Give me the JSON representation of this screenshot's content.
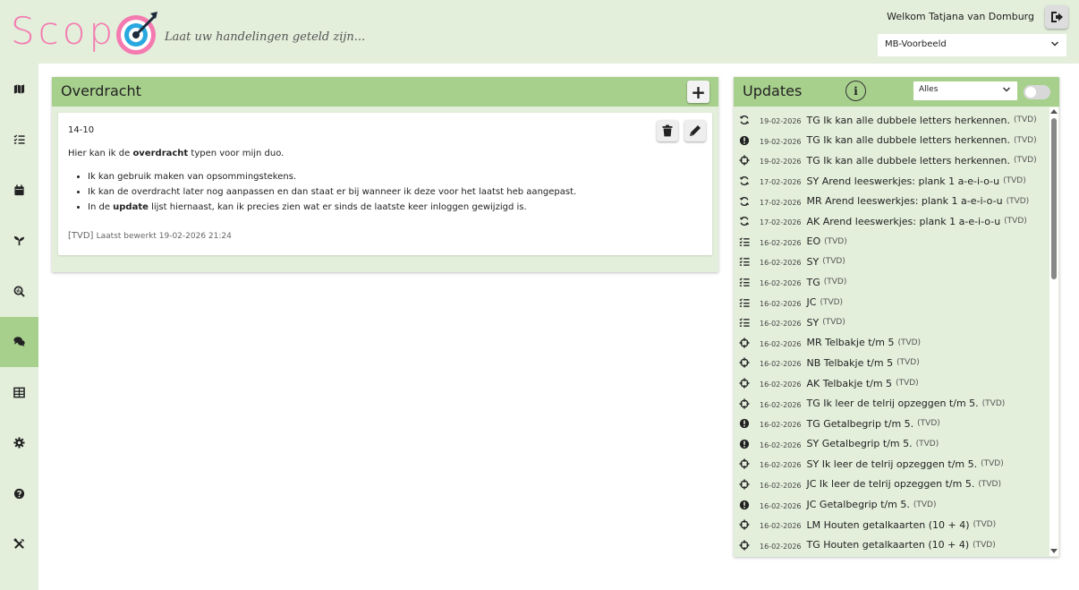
{
  "header": {
    "logo_text": "Scop",
    "tagline": "Laat uw handelingen geteld zijn...",
    "welcome": "Welkom Tatjana van Domburg",
    "school_select": "MB-Voorbeeld"
  },
  "colors": {
    "header_bg": "#e3eedb",
    "panel_head": "#a8d08d",
    "logo_pink": "#f47ab0",
    "logo_blue": "#2aa8e0"
  },
  "sidebar": {
    "items": [
      {
        "icon": "map-icon"
      },
      {
        "icon": "checklist-icon"
      },
      {
        "icon": "calendar-icon"
      },
      {
        "icon": "seedling-icon"
      },
      {
        "icon": "search-chart-icon"
      },
      {
        "icon": "chat-icon",
        "active": true
      },
      {
        "icon": "table-icon"
      },
      {
        "icon": "gear-icon"
      },
      {
        "icon": "help-icon"
      },
      {
        "icon": "tools-icon"
      }
    ]
  },
  "overdracht": {
    "title": "Overdracht",
    "add_label": "+",
    "note": {
      "date": "14-10",
      "intro_pre": "Hier kan ik de",
      "intro_bold": "overdracht",
      "intro_post": "typen voor mijn duo.",
      "bullets": [
        {
          "pre": "Ik kan gebruik maken van opsommingstekens.",
          "bold": "",
          "post": ""
        },
        {
          "pre": "Ik kan de overdracht later nog aanpassen en dan staat er bij wanneer ik deze voor het laatst heb aangepast.",
          "bold": "",
          "post": ""
        },
        {
          "pre": "In de",
          "bold": "update",
          "post": "lijst hiernaast, kan ik precies zien wat er sinds de laatste keer inloggen gewijzigd is."
        }
      ],
      "author": "[TVD]",
      "edited": "Laatst bewerkt 19-02-2026 21:24"
    }
  },
  "updates": {
    "title": "Updates",
    "info_label": "i",
    "filter": "Alles",
    "rows": [
      {
        "icon": "sync-icon",
        "date": "19-02-2026",
        "text": "TG Ik kan alle dubbele letters herkennen.",
        "by": "(TVD)"
      },
      {
        "icon": "alert-icon",
        "date": "19-02-2026",
        "text": "TG Ik kan alle dubbele letters herkennen.",
        "by": "(TVD)"
      },
      {
        "icon": "crosshair-icon",
        "date": "19-02-2026",
        "text": "TG Ik kan alle dubbele letters herkennen.",
        "by": "(TVD)"
      },
      {
        "icon": "sync-icon",
        "date": "17-02-2026",
        "text": "SY Arend leeswerkjes: plank 1 a-e-i-o-u",
        "by": "(TVD)"
      },
      {
        "icon": "sync-icon",
        "date": "17-02-2026",
        "text": "MR Arend leeswerkjes: plank 1 a-e-i-o-u",
        "by": "(TVD)"
      },
      {
        "icon": "sync-icon",
        "date": "17-02-2026",
        "text": "AK Arend leeswerkjes: plank 1 a-e-i-o-u",
        "by": "(TVD)"
      },
      {
        "icon": "checklist-icon",
        "date": "16-02-2026",
        "text": "EO",
        "by": "(TVD)"
      },
      {
        "icon": "checklist-icon",
        "date": "16-02-2026",
        "text": "SY",
        "by": "(TVD)"
      },
      {
        "icon": "checklist-icon",
        "date": "16-02-2026",
        "text": "TG",
        "by": "(TVD)"
      },
      {
        "icon": "checklist-icon",
        "date": "16-02-2026",
        "text": "JC",
        "by": "(TVD)"
      },
      {
        "icon": "checklist-icon",
        "date": "16-02-2026",
        "text": "SY",
        "by": "(TVD)"
      },
      {
        "icon": "crosshair-icon",
        "date": "16-02-2026",
        "text": "MR Telbakje t/m 5",
        "by": "(TVD)"
      },
      {
        "icon": "crosshair-icon",
        "date": "16-02-2026",
        "text": "NB Telbakje t/m 5",
        "by": "(TVD)"
      },
      {
        "icon": "crosshair-icon",
        "date": "16-02-2026",
        "text": "AK Telbakje t/m 5",
        "by": "(TVD)"
      },
      {
        "icon": "crosshair-icon",
        "date": "16-02-2026",
        "text": "TG Ik leer de telrij opzeggen t/m 5.",
        "by": "(TVD)"
      },
      {
        "icon": "alert-icon",
        "date": "16-02-2026",
        "text": "TG Getalbegrip t/m 5.",
        "by": "(TVD)"
      },
      {
        "icon": "alert-icon",
        "date": "16-02-2026",
        "text": "SY Getalbegrip t/m 5.",
        "by": "(TVD)"
      },
      {
        "icon": "crosshair-icon",
        "date": "16-02-2026",
        "text": "SY Ik leer de telrij opzeggen t/m 5.",
        "by": "(TVD)"
      },
      {
        "icon": "crosshair-icon",
        "date": "16-02-2026",
        "text": "JC Ik leer de telrij opzeggen t/m 5.",
        "by": "(TVD)"
      },
      {
        "icon": "alert-icon",
        "date": "16-02-2026",
        "text": "JC Getalbegrip t/m 5.",
        "by": "(TVD)"
      },
      {
        "icon": "crosshair-icon",
        "date": "16-02-2026",
        "text": "LM Houten getalkaarten (10 + 4)",
        "by": "(TVD)"
      },
      {
        "icon": "crosshair-icon",
        "date": "16-02-2026",
        "text": "TG Houten getalkaarten (10 + 4)",
        "by": "(TVD)"
      }
    ]
  }
}
